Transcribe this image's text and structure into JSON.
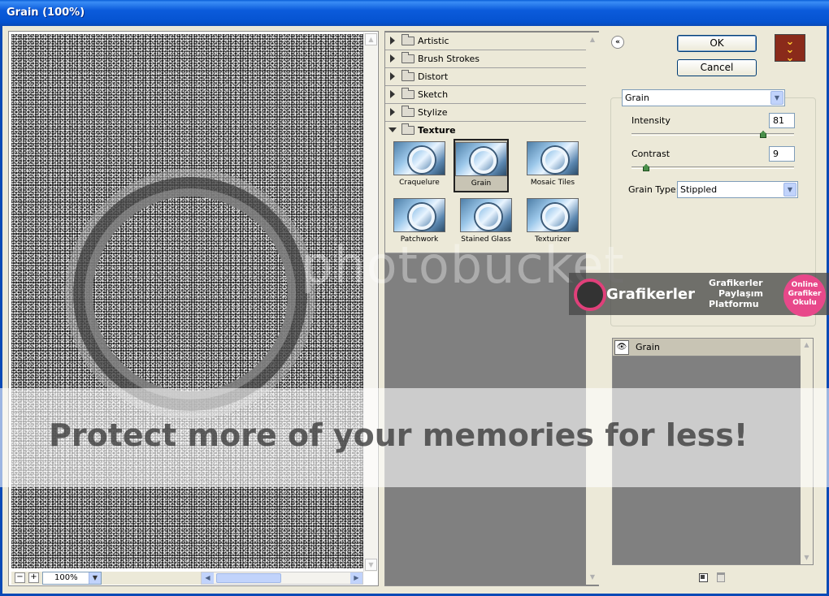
{
  "window": {
    "title": "Grain (100%)"
  },
  "preview": {
    "zoom": "100%"
  },
  "filter_browser": {
    "categories": [
      {
        "label": "Artistic",
        "expanded": false
      },
      {
        "label": "Brush Strokes",
        "expanded": false
      },
      {
        "label": "Distort",
        "expanded": false
      },
      {
        "label": "Sketch",
        "expanded": false
      },
      {
        "label": "Stylize",
        "expanded": false
      },
      {
        "label": "Texture",
        "expanded": true
      }
    ],
    "texture_filters": [
      {
        "label": "Craquelure",
        "selected": false
      },
      {
        "label": "Grain",
        "selected": true
      },
      {
        "label": "Mosaic Tiles",
        "selected": false
      },
      {
        "label": "Patchwork",
        "selected": false
      },
      {
        "label": "Stained Glass",
        "selected": false
      },
      {
        "label": "Texturizer",
        "selected": false
      }
    ]
  },
  "buttons": {
    "ok": "OK",
    "cancel": "Cancel"
  },
  "settings": {
    "filter": "Grain",
    "intensity_label": "Intensity",
    "intensity_value": "81",
    "intensity_max": 100,
    "contrast_label": "Contrast",
    "contrast_value": "9",
    "contrast_max": 100,
    "grain_type_label": "Grain Type:",
    "grain_type_value": "Stippled"
  },
  "layers": [
    {
      "name": "Grain",
      "visible": true
    }
  ],
  "watermarks": {
    "photobucket": "photobucket",
    "protect": "Protect more of your memories for less!",
    "site_name": "Grafikerler",
    "site_tag_1": "Grafikerler",
    "site_tag_2": "Paylaşım",
    "site_tag_3": "Platformu",
    "badge_1": "Online",
    "badge_2": "Grafiker",
    "badge_3": "Okulu"
  },
  "colors": {
    "titlebar": "#0553D0",
    "dialog_bg": "#ECE9D8",
    "selected_thumb": "#C8C4B4"
  }
}
